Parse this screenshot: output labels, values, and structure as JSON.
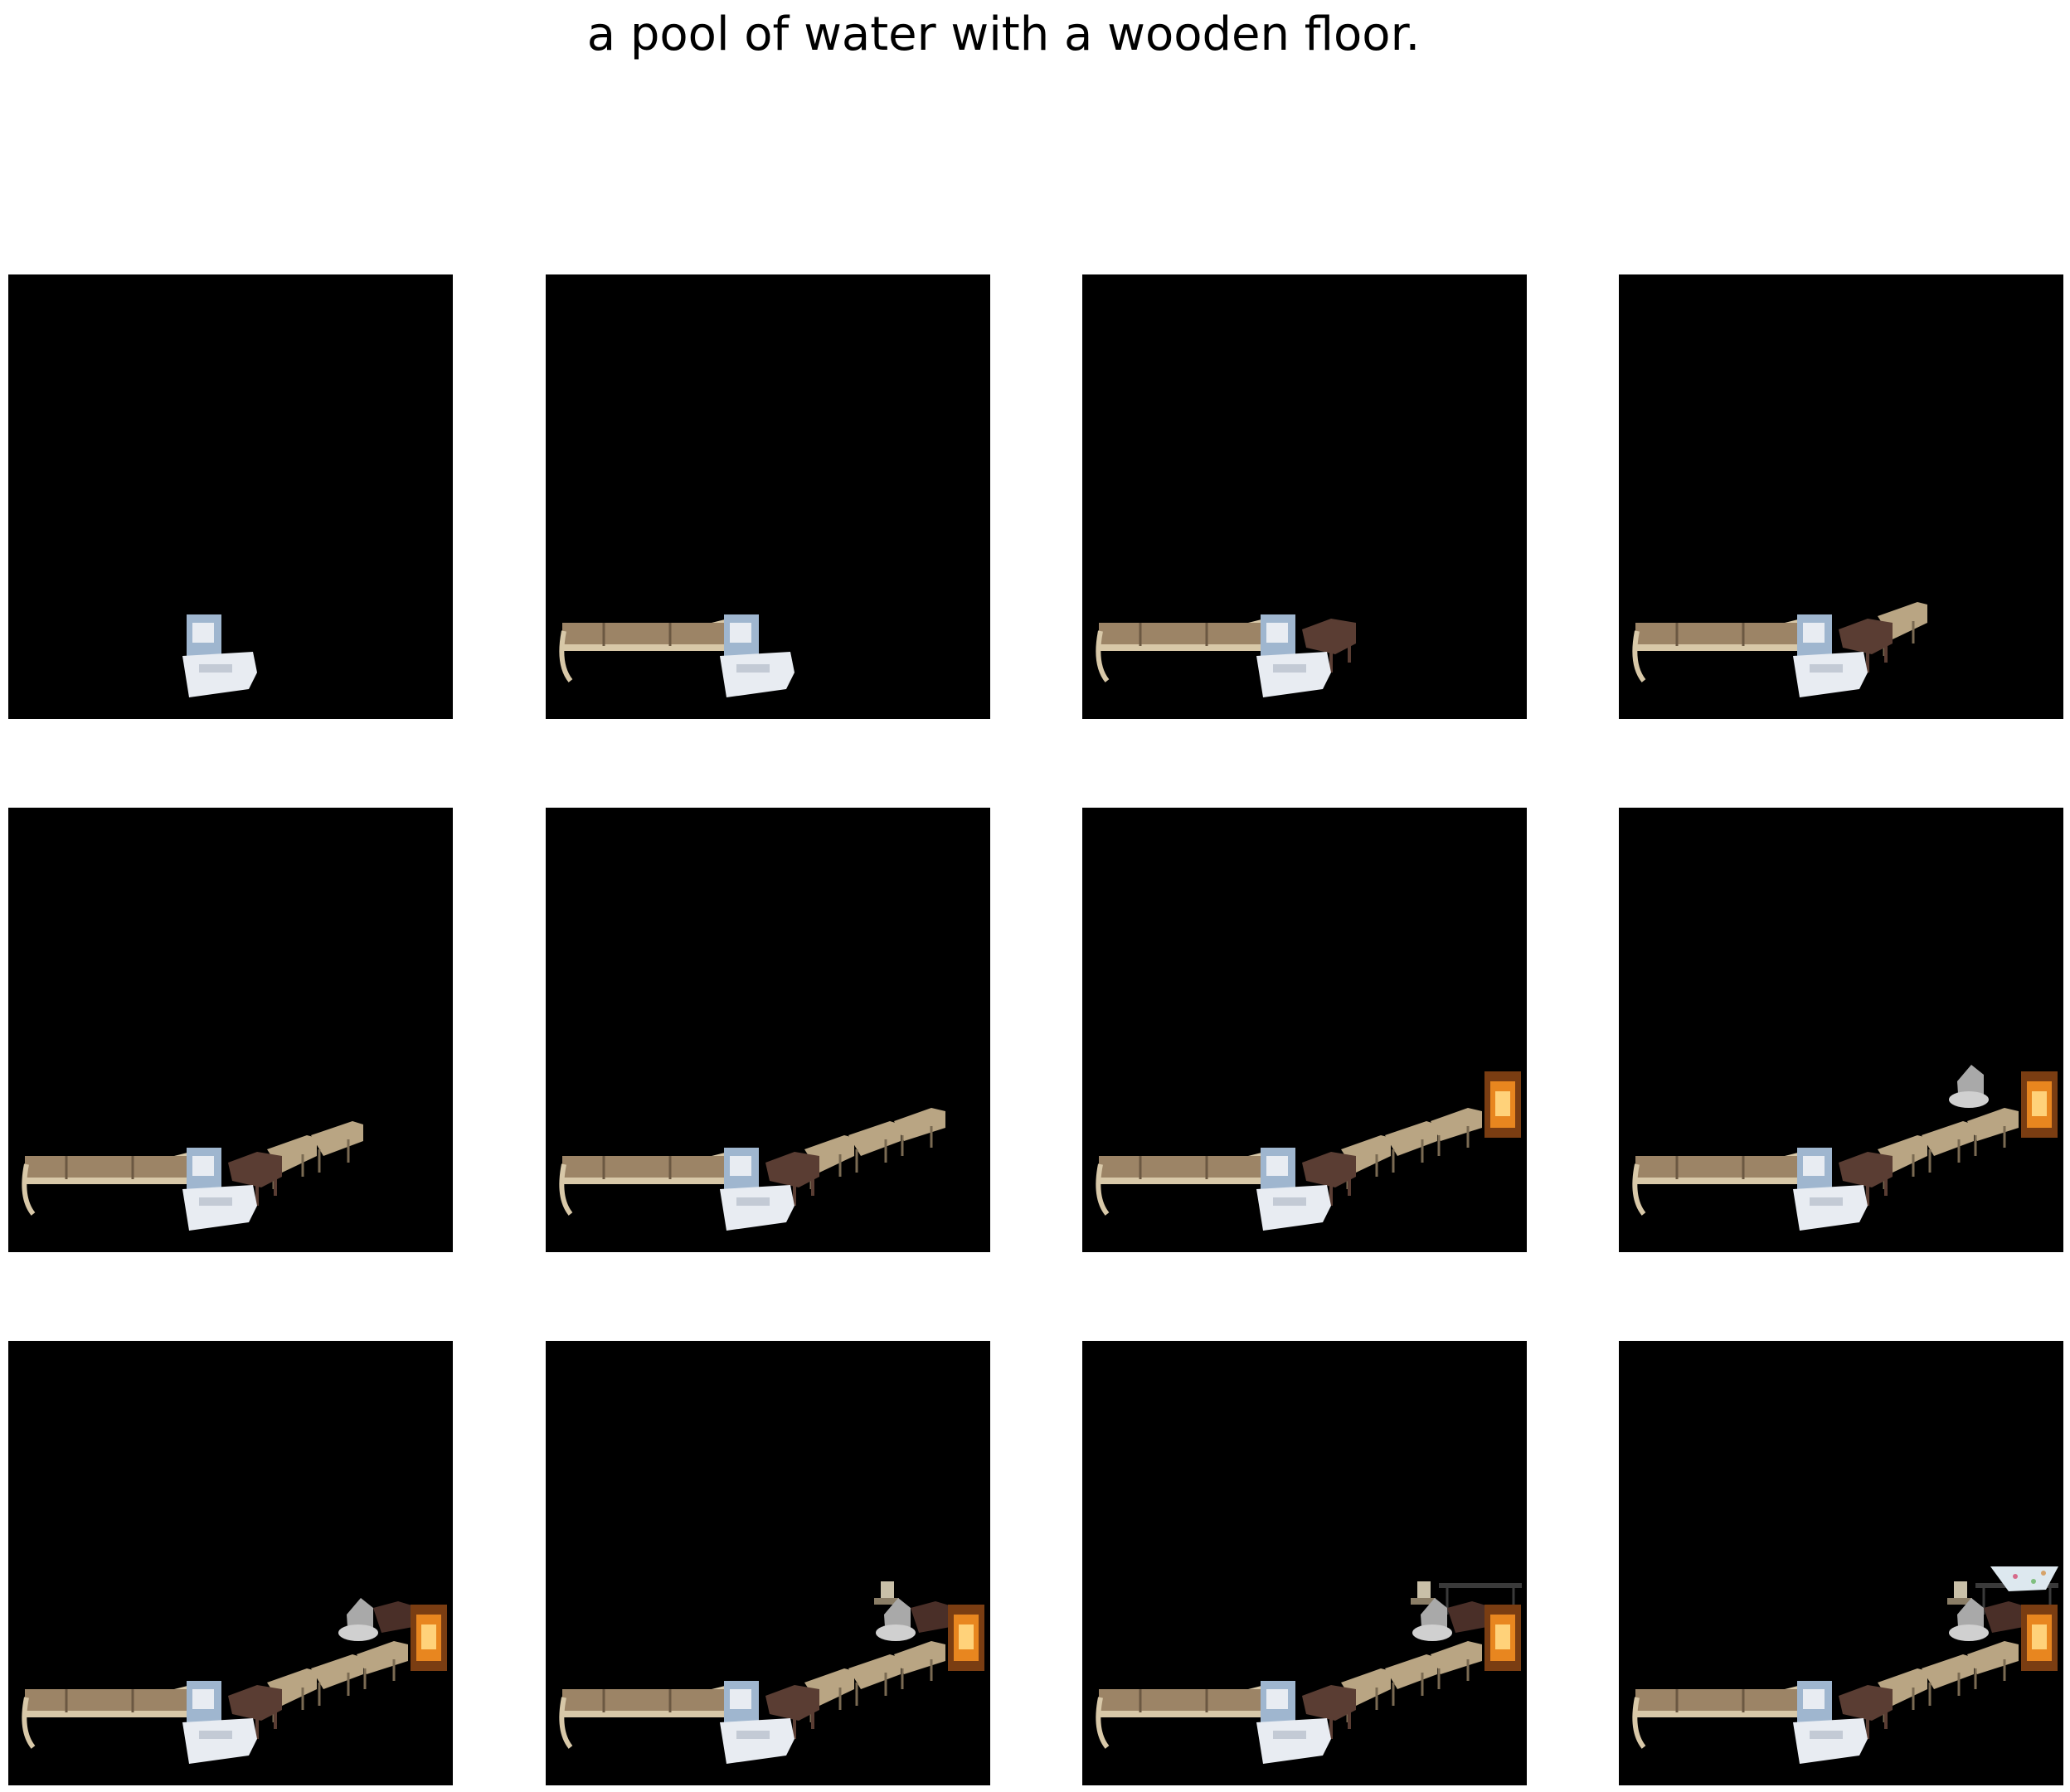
{
  "title": "a pool of water with a wooden floor.",
  "colors": {
    "background": "#000000",
    "bench_wood": "#9c8466",
    "bench_light": "#d8c8a8",
    "chair_white": "#e8ecf2",
    "chair_blue": "#9fb6cf",
    "chair_dark": "#5a3d33",
    "chair_row": "#b9a583",
    "fireplace": "#e8861f",
    "gray_seat": "#a9a9a9",
    "table_dark": "#3a3a3a",
    "glass_table": "#dde8ef"
  },
  "panels": [
    {
      "objects": [
        "white-chair"
      ]
    },
    {
      "objects": [
        "white-chair",
        "bench"
      ]
    },
    {
      "objects": [
        "white-chair",
        "bench",
        "dark-chair"
      ]
    },
    {
      "objects": [
        "white-chair",
        "bench",
        "dark-chair",
        "chair-row-1"
      ]
    },
    {
      "objects": [
        "white-chair",
        "bench",
        "dark-chair",
        "chair-row-1",
        "chair-row-2"
      ]
    },
    {
      "objects": [
        "white-chair",
        "bench",
        "dark-chair",
        "chair-row-1",
        "chair-row-2",
        "chair-row-3"
      ]
    },
    {
      "objects": [
        "white-chair",
        "bench",
        "dark-chair",
        "chair-row-1",
        "chair-row-2",
        "chair-row-3",
        "fireplace"
      ]
    },
    {
      "objects": [
        "white-chair",
        "bench",
        "dark-chair",
        "chair-row-1",
        "chair-row-2",
        "chair-row-3",
        "fireplace",
        "gray-seat"
      ]
    },
    {
      "objects": [
        "white-chair",
        "bench",
        "dark-chair",
        "chair-row-1",
        "chair-row-2",
        "chair-row-3",
        "fireplace",
        "gray-seat",
        "dark-armchair"
      ]
    },
    {
      "objects": [
        "white-chair",
        "bench",
        "dark-chair",
        "chair-row-1",
        "chair-row-2",
        "chair-row-3",
        "fireplace",
        "gray-seat",
        "dark-armchair",
        "side-chair"
      ]
    },
    {
      "objects": [
        "white-chair",
        "bench",
        "dark-chair",
        "chair-row-1",
        "chair-row-2",
        "chair-row-3",
        "fireplace",
        "gray-seat",
        "dark-armchair",
        "side-chair",
        "long-table"
      ]
    },
    {
      "objects": [
        "white-chair",
        "bench",
        "dark-chair",
        "chair-row-1",
        "chair-row-2",
        "chair-row-3",
        "fireplace",
        "gray-seat",
        "dark-armchair",
        "side-chair",
        "long-table",
        "glass-table"
      ]
    }
  ]
}
